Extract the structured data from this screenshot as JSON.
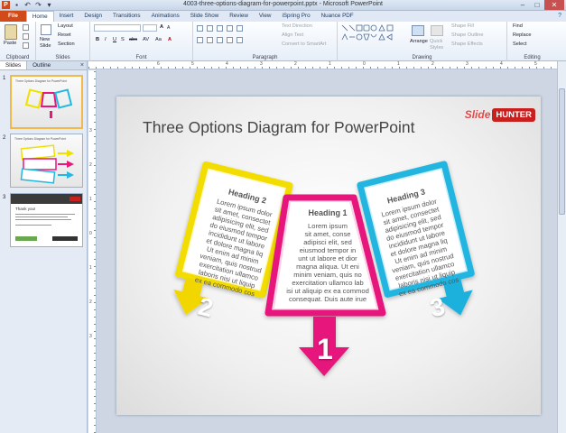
{
  "window": {
    "title": "4003-three-options-diagram-for-powerpoint.pptx - Microsoft PowerPoint",
    "qat_icons": [
      "powerpoint-logo-icon",
      "save-icon",
      "undo-icon",
      "redo-icon",
      "customize-icon"
    ]
  },
  "tabs": [
    "File",
    "Home",
    "Insert",
    "Design",
    "Transitions",
    "Animations",
    "Slide Show",
    "Review",
    "View",
    "iSpring Pro",
    "Nuance PDF"
  ],
  "active_tab": "Home",
  "ribbon": {
    "clipboard": {
      "label": "Clipboard",
      "paste": "Paste"
    },
    "slides": {
      "label": "Slides",
      "new_slide": "New\nSlide",
      "layout": "Layout",
      "reset": "Reset",
      "section": "Section"
    },
    "font": {
      "label": "Font",
      "bold": "B",
      "italic": "I",
      "underline": "U",
      "strike": "S",
      "abc": "abc",
      "spacing": "AV",
      "case": "Aa",
      "color": "A",
      "grow": "A",
      "shrink": "A"
    },
    "paragraph": {
      "label": "Paragraph",
      "text_direction": "Text Direction",
      "align_text": "Align Text",
      "smartart": "Convert to SmartArt"
    },
    "drawing": {
      "label": "Drawing",
      "arrange": "Arrange",
      "quick_styles": "Quick\nStyles",
      "shape_fill": "Shape Fill",
      "shape_outline": "Shape Outline",
      "shape_effects": "Shape Effects"
    },
    "editing": {
      "label": "Editing",
      "find": "Find",
      "replace": "Replace",
      "select": "Select"
    }
  },
  "sidebar": {
    "tabs": [
      "Slides",
      "Outline"
    ],
    "close": "×",
    "slide_numbers": [
      "1",
      "2",
      "3"
    ]
  },
  "ruler": {
    "h_labels": [
      "6",
      "5",
      "4",
      "3",
      "2",
      "1",
      "0",
      "1",
      "2",
      "3",
      "4",
      "5",
      "6"
    ],
    "v_labels": [
      "3",
      "2",
      "1",
      "0",
      "1",
      "2",
      "3"
    ]
  },
  "slide": {
    "title": "Three Options Diagram for PowerPoint",
    "logo_slide": "Slide",
    "logo_hunter": "HUNTER",
    "cards": [
      {
        "heading": "Heading 2",
        "number": "2",
        "color": "#f5e400",
        "lines": [
          "Lorem ipsum dolor",
          "sit amet, consectet",
          "adipisicing elit, sed",
          "do eiusmod tempor",
          "incididunt ut labore",
          "et dolore magna liq",
          "Ut enim ad minim",
          "veniam, quis nostrud",
          "exercitation ullamco",
          "laboris nisi ut liquip",
          "ex ea commodo cos"
        ]
      },
      {
        "heading": "Heading 1",
        "number": "1",
        "color": "#e6187c",
        "lines": [
          "Lorem ipsum",
          "sit amet, conse",
          "adipisci elit, sed",
          "eiusmod tempor in",
          "unt ut labore et dior",
          "magna aliqua. Ut eni",
          "minim veniam, quis no",
          "exercitation ullamco lab",
          "isi ut aliquip ex ea commod",
          "consequat. Duis aute irue"
        ]
      },
      {
        "heading": "Heading 3",
        "number": "3",
        "color": "#22b8e0",
        "lines": [
          "Lorem ipsum dolor",
          "sit amet, consectet",
          "adipisicing elit, sed",
          "do eiusmod tempor",
          "incididunt ut labore",
          "et dolore magna liq",
          "Ut enim ad minim",
          "veniam, quis nostrud",
          "exercitation ullamco",
          "laboris nisi ut liquip",
          "ex ea commodo cos"
        ]
      }
    ]
  },
  "thumbnails": [
    {
      "title": "Three Options Diagram for PowerPoint"
    },
    {
      "title": "Three Options Diagram for PowerPoint"
    },
    {
      "title": "Thank you!"
    }
  ]
}
